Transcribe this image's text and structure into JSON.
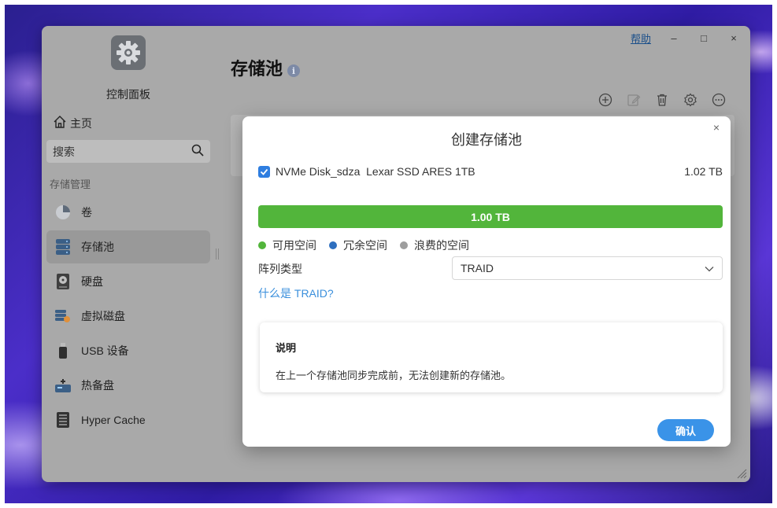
{
  "window": {
    "help_label": "帮助",
    "minimize_glyph": "–",
    "maximize_glyph": "□",
    "close_glyph": "×"
  },
  "sidebar": {
    "title": "控制面板",
    "home_label": "主页",
    "search": {
      "placeholder": "搜索"
    },
    "section_label": "存储管理",
    "items": [
      {
        "label": "卷",
        "icon": "pie-chart-icon",
        "active": false
      },
      {
        "label": "存储池",
        "icon": "database-icon",
        "active": true
      },
      {
        "label": "硬盘",
        "icon": "hard-disk-icon",
        "active": false
      },
      {
        "label": "虚拟磁盘",
        "icon": "virtual-disk-icon",
        "active": false
      },
      {
        "label": "USB 设备",
        "icon": "usb-drive-icon",
        "active": false
      },
      {
        "label": "热备盘",
        "icon": "hot-spare-icon",
        "active": false
      },
      {
        "label": "Hyper Cache",
        "icon": "ssd-cache-icon",
        "active": false
      }
    ]
  },
  "main": {
    "title": "存储池",
    "info_glyph": "i",
    "toolbar": [
      "add-icon",
      "edit-icon",
      "delete-icon",
      "settings-icon",
      "more-icon"
    ]
  },
  "dialog": {
    "title": "创建存储池",
    "close_glyph": "×",
    "disk": {
      "checked": true,
      "name": "NVMe Disk_sdza  Lexar SSD ARES 1TB",
      "size": "1.02 TB"
    },
    "capacity_bar": {
      "label": "1.00 TB",
      "used_fraction": 1.0
    },
    "legend": [
      {
        "label": "可用空间",
        "color": "#52b53b"
      },
      {
        "label": "冗余空间",
        "color": "#2e6fbf"
      },
      {
        "label": "浪费的空间",
        "color": "#9e9e9e"
      }
    ],
    "array_type_label": "阵列类型",
    "array_type_value": "TRAID",
    "help_link": "什么是 TRAID?",
    "note": {
      "title": "说明",
      "text": "在上一个存储池同步完成前，无法创建新的存储池。"
    },
    "confirm_label": "确认"
  },
  "colors": {
    "accent": "#3a93e8",
    "bar_green": "#52b53b",
    "checkbox_blue": "#2f7ee0",
    "link_blue": "#3a8fdc"
  }
}
